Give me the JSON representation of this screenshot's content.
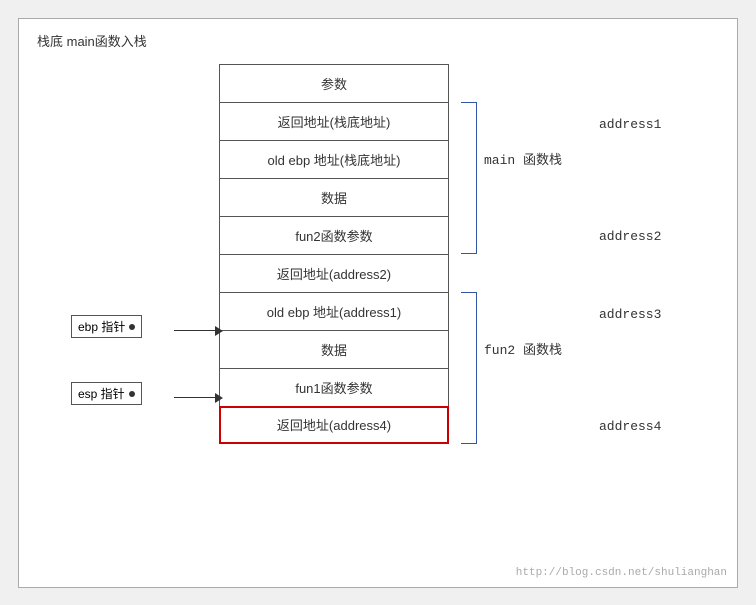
{
  "title": "栈底 main函数入栈",
  "cells": [
    {
      "id": "cell-params",
      "text": "参数",
      "highlight": false
    },
    {
      "id": "cell-retaddr1",
      "text": "返回地址(栈底地址)",
      "highlight": false
    },
    {
      "id": "cell-oldebp1",
      "text": "old ebp 地址(栈底地址)",
      "highlight": false
    },
    {
      "id": "cell-data1",
      "text": "数据",
      "highlight": false
    },
    {
      "id": "cell-fun2params",
      "text": "fun2函数参数",
      "highlight": false
    },
    {
      "id": "cell-retaddr2",
      "text": "返回地址(address2)",
      "highlight": false
    },
    {
      "id": "cell-oldebp2",
      "text": "old ebp 地址(address1)",
      "highlight": false
    },
    {
      "id": "cell-data2",
      "text": "数据",
      "highlight": false
    },
    {
      "id": "cell-fun1params",
      "text": "fun1函数参数",
      "highlight": false
    },
    {
      "id": "cell-retaddr3",
      "text": "返回地址(address4)",
      "highlight": true
    }
  ],
  "addresses": {
    "address1": "address1",
    "address2": "address2",
    "address3": "address3",
    "address4": "address4"
  },
  "brackets": {
    "main_label": "main 函数栈",
    "fun2_label": "fun2 函数栈"
  },
  "pointers": {
    "ebp": "ebp 指针",
    "esp": "esp 指针"
  },
  "watermark": "http://blog.csdn.net/shulianghan"
}
